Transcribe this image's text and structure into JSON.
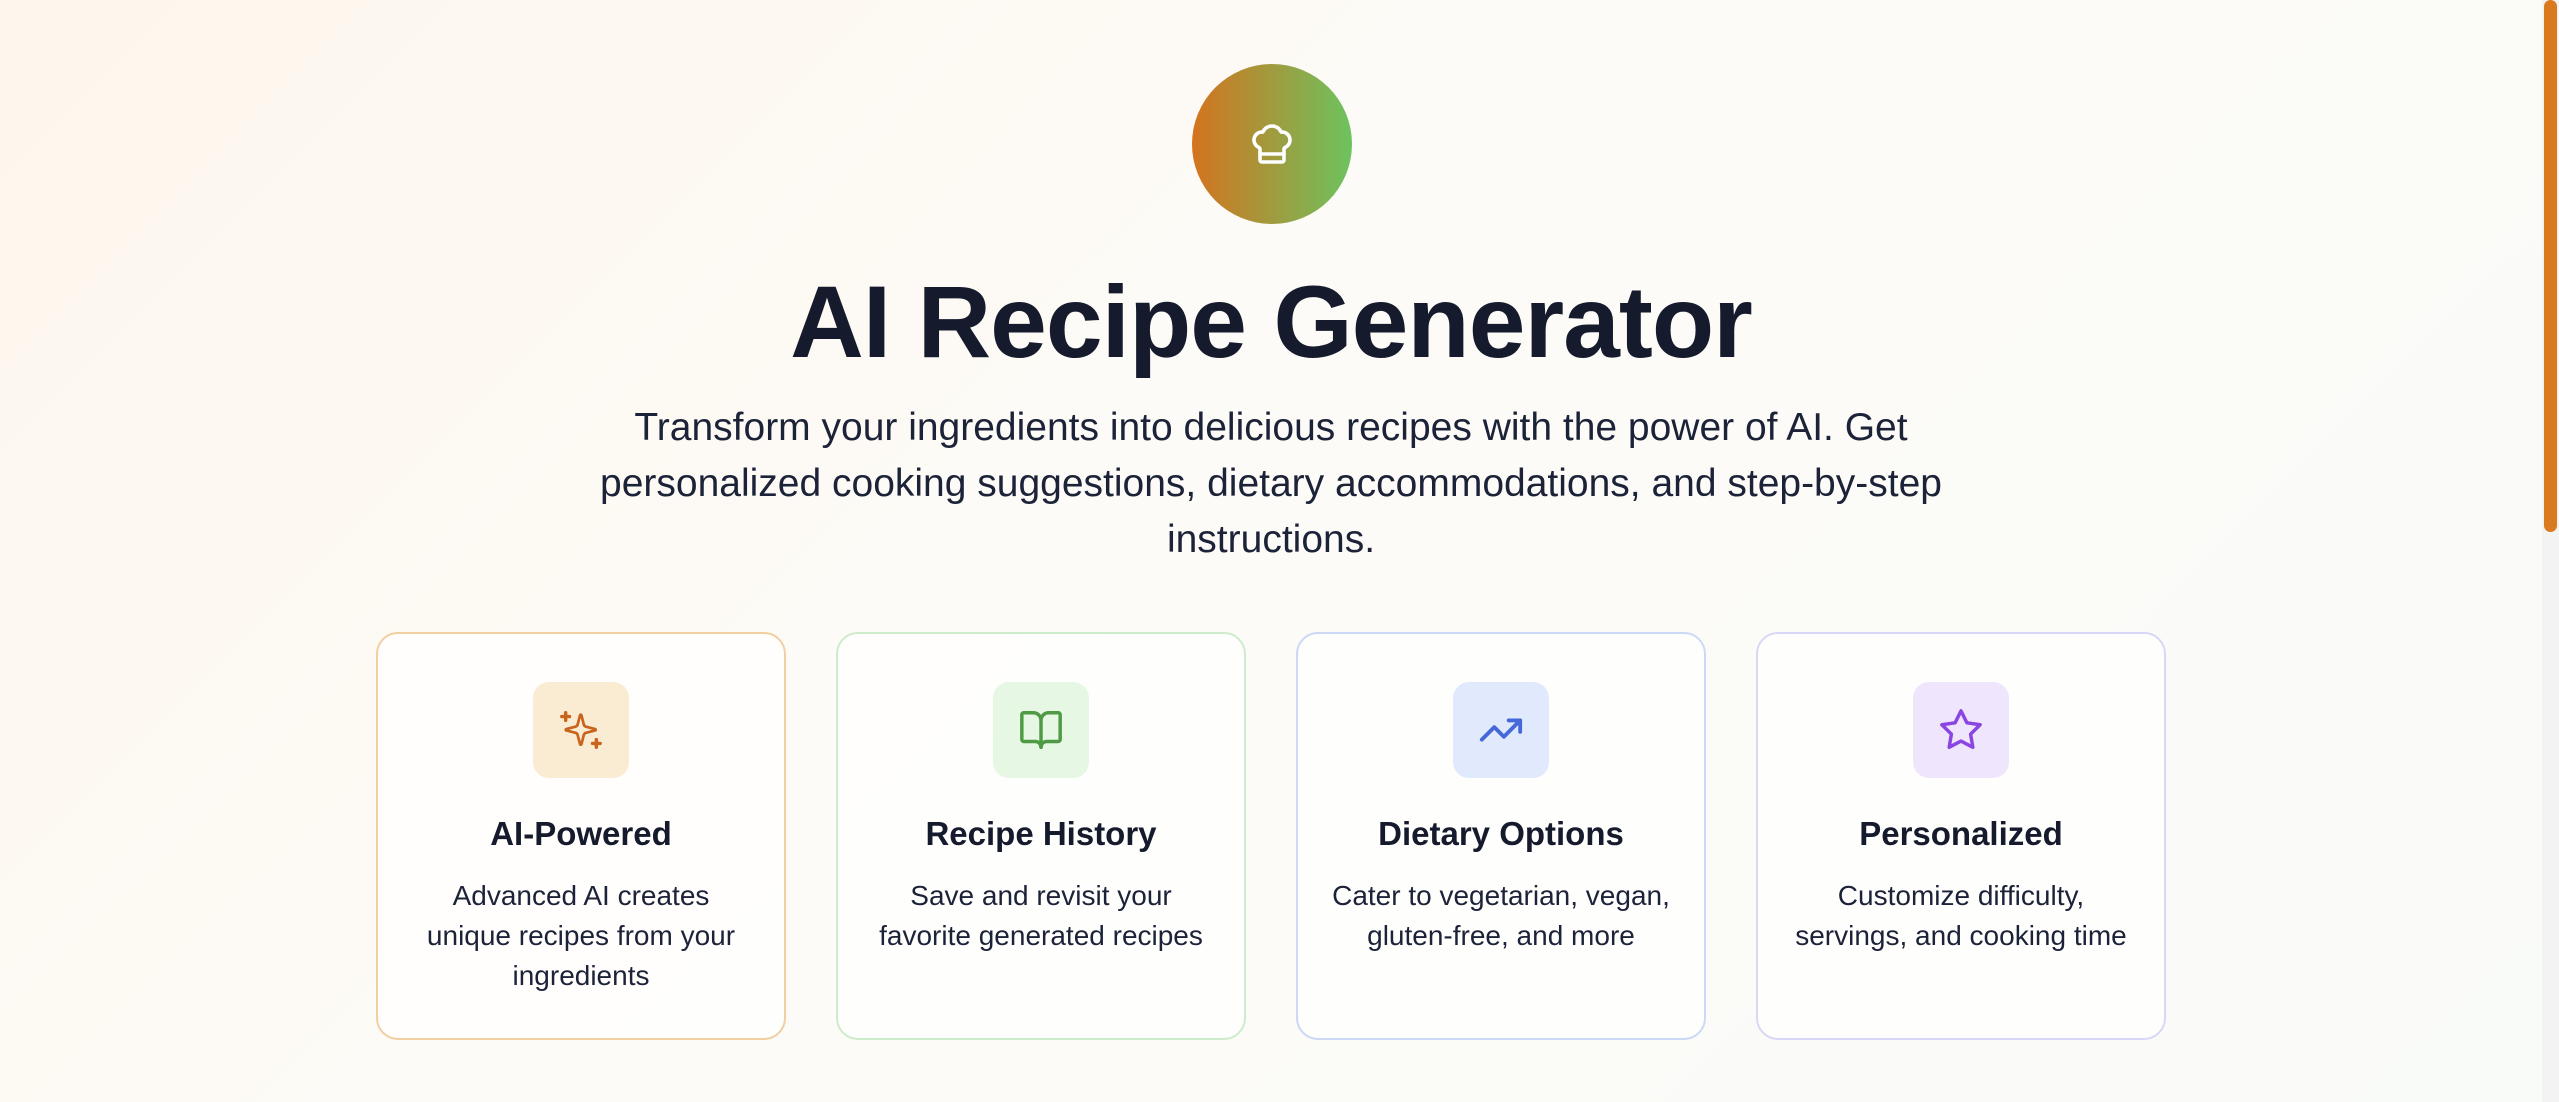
{
  "hero": {
    "logo_icon": "chef-hat-icon",
    "logo_gradient": [
      "#d4731e",
      "#6cc35f"
    ],
    "title": "AI Recipe Generator",
    "subtitle": "Transform your ingredients into delicious recipes with the power of AI. Get personalized cooking suggestions, dietary accommodations, and step-by-step instructions."
  },
  "features": [
    {
      "title": "AI-Powered",
      "description": "Advanced AI creates unique recipes from your ingredients",
      "icon": "sparkles-icon",
      "icon_color": "#c8641c",
      "icon_bg": "#faebd3",
      "border_color": "#f1cfa3"
    },
    {
      "title": "Recipe History",
      "description": "Save and revisit your favorite generated recipes",
      "icon": "book-open-icon",
      "icon_color": "#4f9a44",
      "icon_bg": "#e6f7e4",
      "border_color": "#cdeccb"
    },
    {
      "title": "Dietary Options",
      "description": "Cater to vegetarian, vegan, gluten-free, and more",
      "icon": "trending-up-icon",
      "icon_color": "#4468d9",
      "icon_bg": "#e1e9fd",
      "border_color": "#cbd8f6"
    },
    {
      "title": "Personalized",
      "description": "Customize difficulty, servings, and cooking time",
      "icon": "star-icon",
      "icon_color": "#8a45e2",
      "icon_bg": "#efe6fd",
      "border_color": "#d8d8f6"
    }
  ],
  "scrollbar": {
    "thumb_color": "#d97a1f"
  }
}
